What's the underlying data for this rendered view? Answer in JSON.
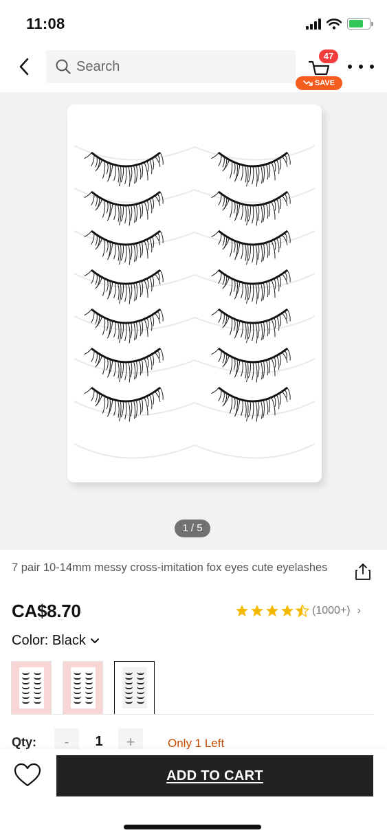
{
  "status": {
    "time": "11:08",
    "battery_level": 0.7,
    "battery_color": "#33c759"
  },
  "header": {
    "back_icon": "chevron-left-icon",
    "search_placeholder": "Search",
    "search_icon": "search-icon",
    "cart_icon": "cart-icon",
    "cart_count": "47",
    "save_label": "SAVE",
    "more_icon": "more-icon"
  },
  "gallery": {
    "pager": "1 / 5",
    "current": 1,
    "total": 5
  },
  "product": {
    "title": "7 pair 10-14mm messy cross-imitation fox eyes cute eyelashes",
    "price": "CA$8.70",
    "rating": 4.5,
    "rating_count": "(1000+)",
    "color_label": "Color: Black",
    "swatches": [
      {
        "name": "pink-1",
        "selected": false
      },
      {
        "name": "pink-2",
        "selected": false
      },
      {
        "name": "black",
        "selected": true
      }
    ]
  },
  "qty": {
    "label": "Qty:",
    "minus": "-",
    "value": "1",
    "plus": "+",
    "stock_note": "Only 1 Left"
  },
  "bottom": {
    "wishlist_icon": "heart-icon",
    "add_to_cart": "ADD TO CART"
  },
  "colors": {
    "badge": "#f23d3d",
    "save": "#f55d1e",
    "star": "#f5b800",
    "stock": "#c44a00",
    "button": "#222222"
  }
}
